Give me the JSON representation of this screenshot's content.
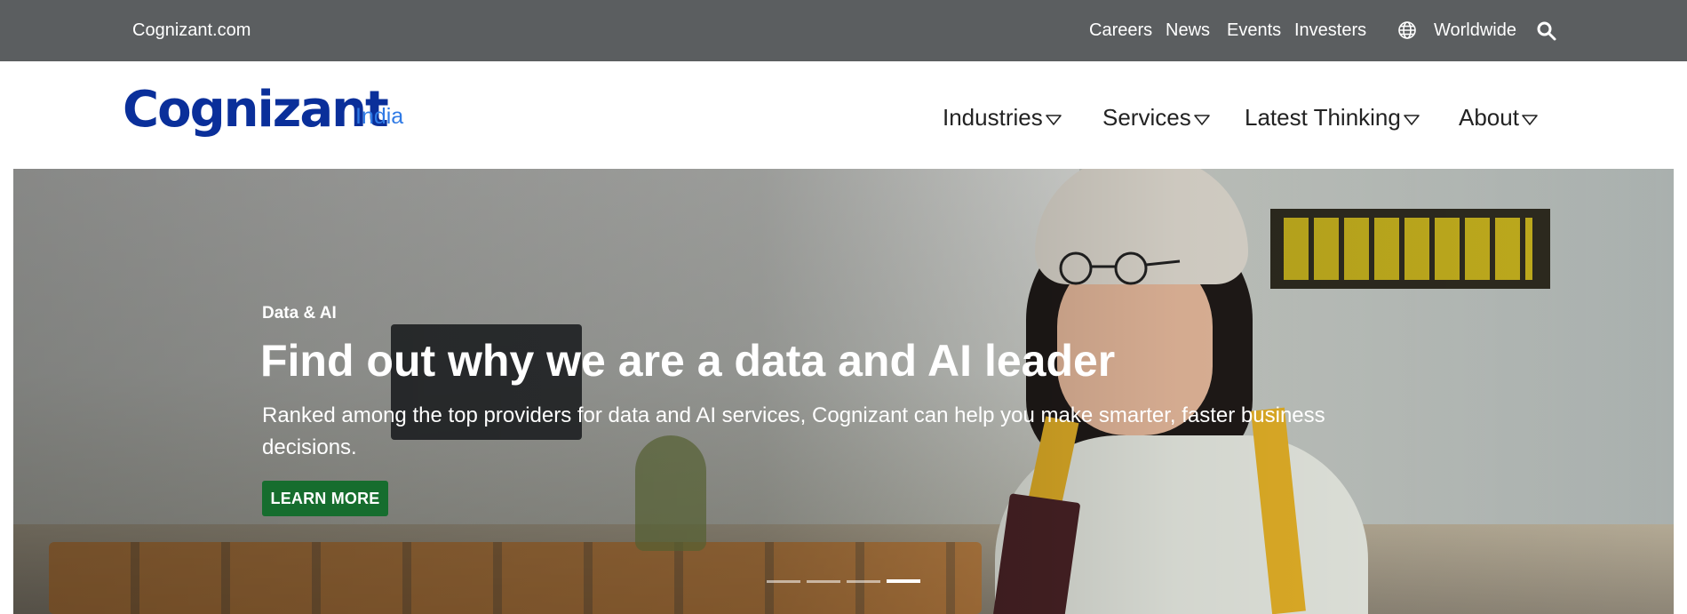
{
  "topbar": {
    "site_link": "Cognizant.com",
    "links": [
      "Careers",
      "News",
      "Events",
      "Investers"
    ],
    "region_label": "Worldwide",
    "globe_icon": "globe-icon",
    "search_icon": "search-icon"
  },
  "header": {
    "logo_text": "Cognizant",
    "region": "India",
    "nav": [
      {
        "label": "Industries"
      },
      {
        "label": "Services"
      },
      {
        "label": "Latest Thinking"
      },
      {
        "label": "About"
      }
    ],
    "nav_caret_icon": "triangle-down-icon"
  },
  "hero": {
    "eyebrow": "Data & AI",
    "headline": "Find out why we are a data and AI leader",
    "subtext": "Ranked among the top providers for data and AI services, Cognizant can help you make smarter, faster business decisions.",
    "cta": "LEARN MORE",
    "carousel": {
      "slides": 4,
      "active": 4
    }
  },
  "colors": {
    "topbar_bg": "#5b5e60",
    "logo": "#0a2f9a",
    "region": "#2f7ae5",
    "cta_bg": "#166d2e"
  }
}
